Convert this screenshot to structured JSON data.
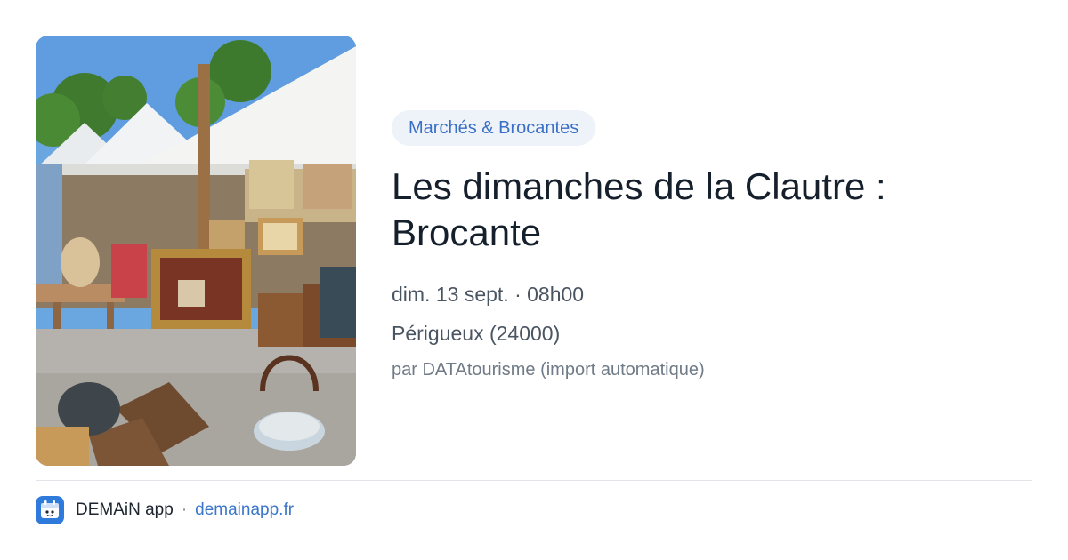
{
  "image": {
    "alt_icon": "flea-market-photo"
  },
  "event": {
    "category": "Marchés & Brocantes",
    "title": "Les dimanches de la Clautre : Brocante",
    "date": "dim. 13 sept. · 08h00",
    "location": "Périgueux (24000)",
    "source": "par DATAtourisme (import automatique)"
  },
  "footer": {
    "app_name": "DEMAiN app",
    "separator": "·",
    "domain": "demainapp.fr",
    "logo_icon": "demain-app-logo-icon"
  },
  "colors": {
    "accent": "#3a6fc6",
    "badge_bg": "#eef3fa",
    "logo_bg": "#2f7bdc"
  }
}
